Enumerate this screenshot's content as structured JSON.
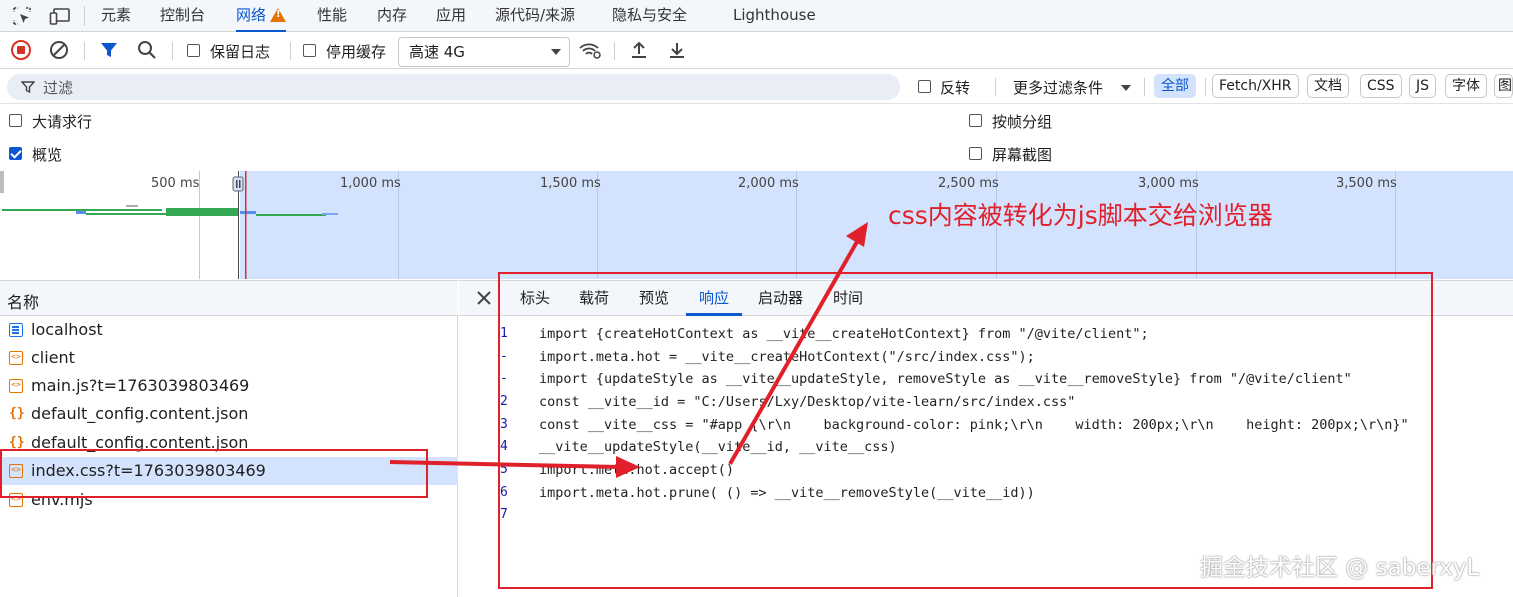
{
  "tabs": {
    "items": [
      "元素",
      "控制台",
      "网络",
      "性能",
      "内存",
      "应用",
      "源代码/来源",
      "隐私与安全",
      "Lighthouse"
    ],
    "active": "网络"
  },
  "toolbar": {
    "preserve_log": "保留日志",
    "disable_cache": "停用缓存",
    "throttle": "高速 4G"
  },
  "filter": {
    "placeholder": "过滤",
    "invert": "反转",
    "more_filters": "更多过滤条件",
    "chips": [
      "全部",
      "Fetch/XHR",
      "文档",
      "CSS",
      "JS",
      "字体",
      "图"
    ]
  },
  "options": {
    "big_rows": "大请求行",
    "overview": "概览",
    "group_by_frame": "按帧分组",
    "screenshots": "屏幕截图"
  },
  "timeline": {
    "ticks": [
      "500 ms",
      "1,000 ms",
      "1,500 ms",
      "2,000 ms",
      "2,500 ms",
      "3,000 ms",
      "3,500 ms"
    ]
  },
  "requests": {
    "header": "名称",
    "items": [
      {
        "name": "localhost",
        "type": "doc"
      },
      {
        "name": "client",
        "type": "script"
      },
      {
        "name": "main.js?t=1763039803469",
        "type": "script"
      },
      {
        "name": "default_config.content.json",
        "type": "json"
      },
      {
        "name": "default_config.content.json",
        "type": "json"
      },
      {
        "name": "index.css?t=1763039803469",
        "type": "script",
        "selected": true
      },
      {
        "name": "env.mjs",
        "type": "script"
      }
    ]
  },
  "detail": {
    "tabs": [
      "标头",
      "载荷",
      "预览",
      "响应",
      "启动器",
      "时间"
    ],
    "active": "响应"
  },
  "code": {
    "line_numbers": [
      "1",
      "-",
      "-",
      "2",
      "3",
      "4",
      "5",
      "6",
      "7"
    ],
    "lines": [
      "import {createHotContext as __vite__createHotContext} from \"/@vite/client\";",
      "import.meta.hot = __vite__createHotContext(\"/src/index.css\");",
      "import {updateStyle as __vite__updateStyle, removeStyle as __vite__removeStyle} from \"/@vite/client\"",
      "const __vite__id = \"C:/Users/Lxy/Desktop/vite-learn/src/index.css\"",
      "const __vite__css = \"#app {\\r\\n    background-color: pink;\\r\\n    width: 200px;\\r\\n    height: 200px;\\r\\n}\"",
      "__vite__updateStyle(__vite__id, __vite__css)",
      "import.meta.hot.accept()",
      "import.meta.hot.prune( () => __vite__removeStyle(__vite__id))",
      ""
    ]
  },
  "annotation": {
    "text": "css内容被转化为js脚本交给浏览器",
    "color": "#e0202a"
  },
  "watermark": "掘金技术社区 @ saberxyL"
}
